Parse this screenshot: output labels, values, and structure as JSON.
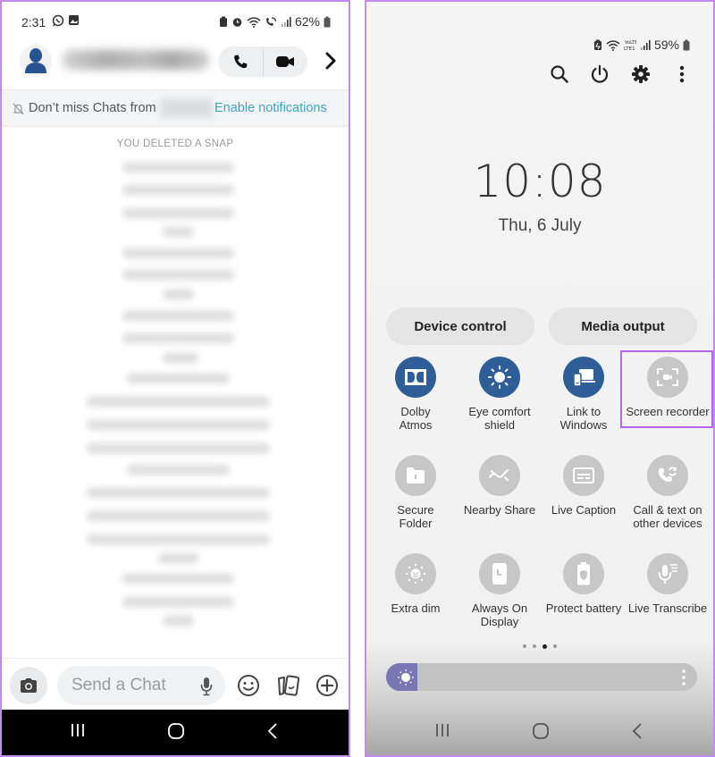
{
  "left_panel": {
    "status_bar": {
      "time": "2:31",
      "left_icons": [
        "whatsapp-icon",
        "gallery-icon"
      ],
      "right_icons": [
        "battery-saver-icon",
        "alarm-icon",
        "wifi-icon",
        "wifi-calling-icon",
        "signal-icon"
      ],
      "battery_percent": "62%"
    },
    "header": {
      "avatar_icon": "person-icon",
      "contact_name": "[blurred]",
      "call_icon": "phone-icon",
      "video_icon": "video-camera-icon",
      "more_icon": "chevron-right-icon"
    },
    "notification_banner": {
      "icon": "bell-off-icon",
      "message": "Don’t miss Chats from",
      "blurred_name": "[blurred]",
      "action": "Enable notifications"
    },
    "conversation": {
      "system_label": "YOU DELETED A SNAP",
      "blurred_messages_count": 21
    },
    "composer": {
      "camera_icon": "camera-icon",
      "input_placeholder": "Send a Chat",
      "mic_icon": "microphone-icon",
      "emoji_icon": "smiley-icon",
      "stickers_icon": "stickers-icon",
      "plus_icon": "plus-circle-icon"
    },
    "nav_bar": [
      "recent-apps-icon",
      "home-icon",
      "back-icon"
    ]
  },
  "right_panel": {
    "status_bar": {
      "icons": [
        "battery-saver-icon",
        "wifi-icon",
        "volte-lte-icon",
        "signal-icon"
      ],
      "battery_percent": "59%"
    },
    "actions": [
      "search-icon",
      "power-icon",
      "settings-icon",
      "more-vertical-icon"
    ],
    "clock": "10:08",
    "date": "Thu, 6 July",
    "pills": [
      {
        "label": "Device control"
      },
      {
        "label": "Media output"
      }
    ],
    "tiles": [
      {
        "label": "Dolby Atmos",
        "icon": "dolby-icon",
        "state": "on"
      },
      {
        "label": "Eye comfort shield",
        "icon": "eye-comfort-icon",
        "state": "on"
      },
      {
        "label": "Link to Windows",
        "icon": "link-to-windows-icon",
        "state": "on"
      },
      {
        "label": "Screen recorder",
        "icon": "screen-recorder-icon",
        "state": "off",
        "highlighted": true
      },
      {
        "label": "Secure Folder",
        "icon": "secure-folder-icon",
        "state": "off"
      },
      {
        "label": "Nearby Share",
        "icon": "nearby-share-icon",
        "state": "off"
      },
      {
        "label": "Live Caption",
        "icon": "live-caption-icon",
        "state": "off"
      },
      {
        "label": "Call & text on other devices",
        "icon": "call-sync-icon",
        "state": "off"
      },
      {
        "label": "Extra dim",
        "icon": "extra-dim-icon",
        "state": "off"
      },
      {
        "label": "Always On Display",
        "icon": "always-on-display-icon",
        "state": "off"
      },
      {
        "label": "Protect battery",
        "icon": "protect-battery-icon",
        "state": "off"
      },
      {
        "label": "Live Transcribe",
        "icon": "live-transcribe-icon",
        "state": "off"
      }
    ],
    "page_indicator": {
      "total": 4,
      "current": 3
    },
    "brightness": {
      "level_percent": 10,
      "icon": "sun-icon",
      "more_icon": "more-vertical-icon"
    },
    "nav_bar": [
      "recent-apps-icon",
      "home-icon",
      "back-icon"
    ]
  },
  "colors": {
    "highlight_border": "#b565f2",
    "tile_active": "#2f5d97",
    "tile_inactive": "#c7c7c7",
    "link_blue": "#3fa3c4",
    "brightness_fill": "#7a76b3"
  }
}
